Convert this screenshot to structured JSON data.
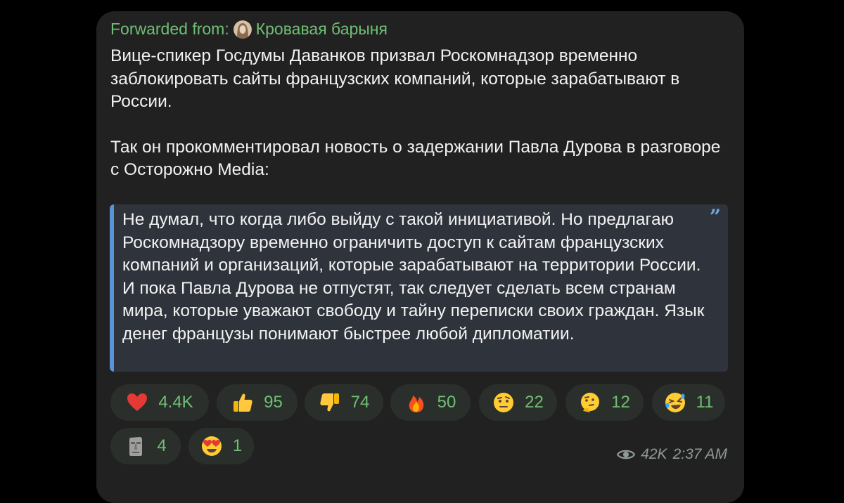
{
  "forwarded": {
    "prefix": "Forwarded from:",
    "channel_name": "Кровавая барыня"
  },
  "message": {
    "paragraphs": [
      "Вице-спикер Госдумы Даванков призвал Роскомнадзор временно заблокировать сайты французских компаний, которые зарабатывают в России.",
      "Так он прокомментировал новость о задержании Павла Дурова в разговоре с Осторожно Media:"
    ],
    "quote": "Не думал, что когда либо выйду с такой инициативой. Но предлагаю Роскомнадзору временно ограничить доступ к сайтам французских компаний и организаций, которые зарабатывают на территории России. И пока Павла Дурова не отпустят, так следует сделать всем странам мира, которые уважают свободу и тайну переписки своих граждан. Язык денег французы понимают быстрее любой дипломатии.",
    "quote_mark": "”"
  },
  "reactions": [
    {
      "icon": "heart-icon",
      "count": "4.4K"
    },
    {
      "icon": "thumbs-up-icon",
      "count": "95"
    },
    {
      "icon": "thumbs-down-icon",
      "count": "74"
    },
    {
      "icon": "fire-icon",
      "count": "50"
    },
    {
      "icon": "raised-eyebrow-face-icon",
      "count": "22"
    },
    {
      "icon": "thinking-face-icon",
      "count": "12"
    },
    {
      "icon": "rolling-laughing-face-icon",
      "count": "11"
    },
    {
      "icon": "moai-icon",
      "count": "4"
    },
    {
      "icon": "heart-eyes-face-icon",
      "count": "1"
    }
  ],
  "meta": {
    "views": "42K",
    "time": "2:37 AM"
  },
  "colors": {
    "background": "#000000",
    "bubble": "#212121",
    "accent_green": "#6fbf73",
    "quote_bar": "#5b93d8",
    "quote_bg": "#2f343c"
  }
}
